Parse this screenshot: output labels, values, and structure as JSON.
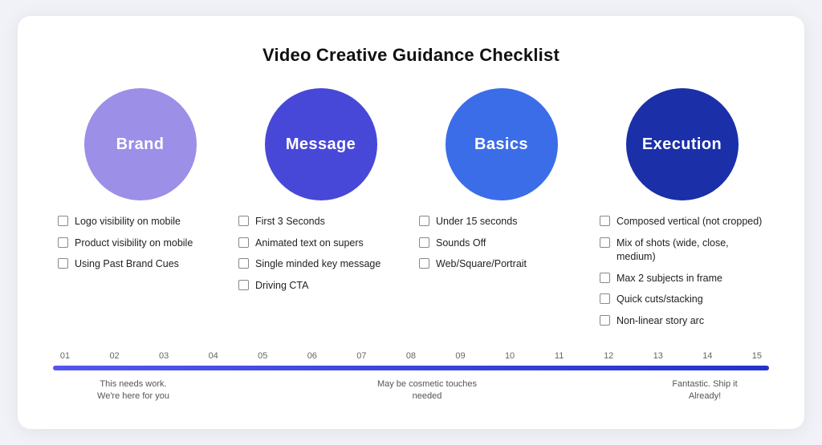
{
  "title": "Video Creative Guidance Checklist",
  "columns": [
    {
      "id": "brand",
      "label": "Brand",
      "circleClass": "circle-brand",
      "items": [
        "Logo visibility on mobile",
        "Product visibility on mobile",
        "Using Past Brand Cues"
      ]
    },
    {
      "id": "message",
      "label": "Message",
      "circleClass": "circle-message",
      "items": [
        "First 3 Seconds",
        "Animated text on supers",
        "Single minded key message",
        "Driving CTA"
      ]
    },
    {
      "id": "basics",
      "label": "Basics",
      "circleClass": "circle-basics",
      "items": [
        "Under 15 seconds",
        "Sounds Off",
        "Web/Square/Portrait"
      ]
    },
    {
      "id": "execution",
      "label": "Execution",
      "circleClass": "circle-exec",
      "items": [
        "Composed vertical (not cropped)",
        "Mix of shots (wide, close, medium)",
        "Max 2 subjects in frame",
        "Quick cuts/stacking",
        "Non-linear story arc"
      ]
    }
  ],
  "timeline": {
    "numbers": [
      "01",
      "02",
      "03",
      "04",
      "05",
      "06",
      "07",
      "08",
      "09",
      "10",
      "11",
      "12",
      "13",
      "14",
      "15"
    ],
    "label_left": "This needs work.\nWe're here for you",
    "label_mid": "May be cosmetic touches\nneeded",
    "label_right": "Fantastic. Ship it\nAlready!"
  }
}
